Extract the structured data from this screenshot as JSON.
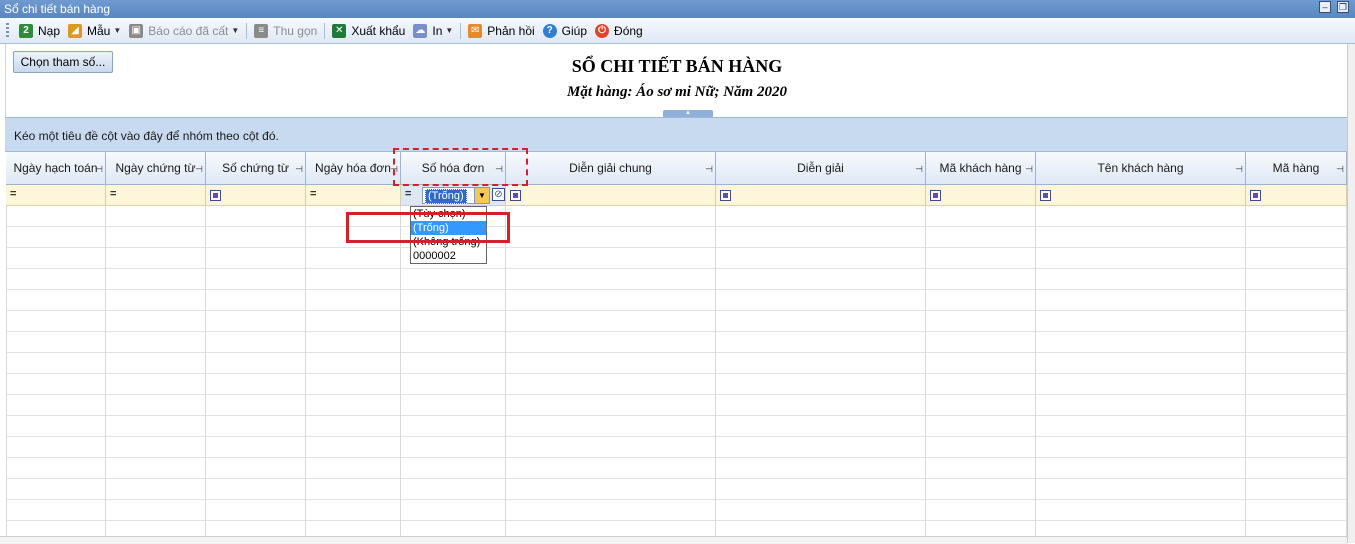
{
  "window": {
    "title": "Sổ chi tiết bán hàng"
  },
  "toolbar": {
    "items": [
      {
        "label": "Nạp",
        "icon": "refresh-icon",
        "enabled": true,
        "color": "#2e8b3a"
      },
      {
        "label": "Mẫu",
        "icon": "template-icon",
        "enabled": true,
        "color": "#d99a1e",
        "dropdown": true
      },
      {
        "label": "Báo cáo đã cất",
        "icon": "save-icon",
        "enabled": false,
        "color": "#8a8a8a",
        "dropdown": true
      },
      {
        "label": "Thu gọn",
        "icon": "collapse-icon",
        "enabled": false,
        "color": "#8a8a8a"
      },
      {
        "label": "Xuất khẩu",
        "icon": "excel-icon",
        "enabled": true,
        "color": "#1f7a3a"
      },
      {
        "label": "In",
        "icon": "print-icon",
        "enabled": true,
        "color": "#7a8fc8",
        "dropdown": true
      },
      {
        "label": "Phản hồi",
        "icon": "mail-icon",
        "enabled": true,
        "color": "#e8892a"
      },
      {
        "label": "Giúp",
        "icon": "help-icon",
        "enabled": true,
        "color": "#2f7fd4"
      },
      {
        "label": "Đóng",
        "icon": "close-icon",
        "enabled": true,
        "color": "#e0452a"
      }
    ]
  },
  "report": {
    "param_button": "Chọn tham số...",
    "title": "SỔ CHI TIẾT BÁN HÀNG",
    "subtitle": "Mặt hàng: Áo sơ mi Nữ; Năm 2020"
  },
  "group_panel": {
    "hint": "Kéo một tiêu đề cột vào đây để nhóm theo cột đó."
  },
  "grid": {
    "columns": [
      {
        "label": "Ngày hạch toán",
        "filter": "eq"
      },
      {
        "label": "Ngày chứng từ",
        "filter": "eq"
      },
      {
        "label": "Số chứng từ",
        "filter": "sq"
      },
      {
        "label": "Ngày hóa đơn",
        "filter": "eq"
      },
      {
        "label": "Số hóa đơn",
        "filter": "combo"
      },
      {
        "label": "Diễn giải chung",
        "filter": "sq"
      },
      {
        "label": "Diễn giải",
        "filter": "sq"
      },
      {
        "label": "Mã khách hàng",
        "filter": "sq"
      },
      {
        "label": "Tên khách hàng",
        "filter": "sq"
      },
      {
        "label": "Mã hàng",
        "filter": "sq"
      }
    ],
    "filter_value": "(Trống)",
    "dropdown_options": [
      "(Tùy chọn)",
      "(Trống)",
      "(Không trống)",
      "0000002"
    ],
    "dropdown_selected": 1
  },
  "highlight_color": "#d4202a"
}
